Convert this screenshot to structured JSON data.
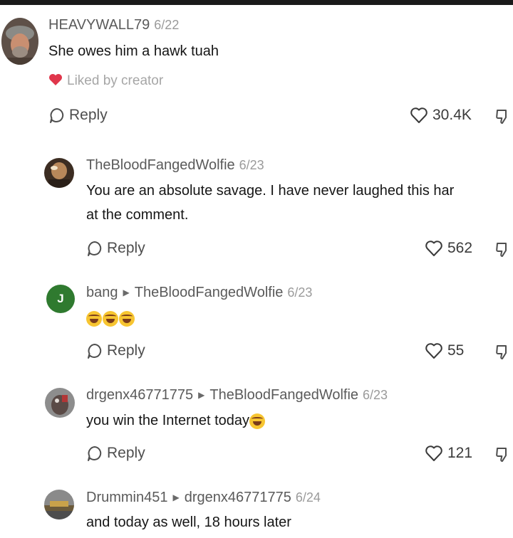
{
  "comments": [
    {
      "username": "HEAVYWALL79",
      "date": "6/22",
      "text": "She owes him a hawk tuah",
      "liked_label": "Liked by creator",
      "reply_label": "Reply",
      "likes": "30.4K"
    },
    {
      "username": "TheBloodFangedWolfie",
      "date": "6/23",
      "text_line1": "You are an absolute savage. I have never laughed this har",
      "text_line2": "at the comment.",
      "reply_label": "Reply",
      "likes": "562"
    },
    {
      "username": "bang",
      "reply_to": "TheBloodFangedWolfie",
      "date": "6/23",
      "avatar_letter": "J",
      "reply_label": "Reply",
      "likes": "55"
    },
    {
      "username": "drgenx46771775",
      "reply_to": "TheBloodFangedWolfie",
      "date": "6/23",
      "text": "you win the Internet today",
      "reply_label": "Reply",
      "likes": "121"
    },
    {
      "username": "Drummin451",
      "reply_to": "drgenx46771775",
      "date": "6/24",
      "text": "and today as well, 18 hours later"
    }
  ],
  "colors": {
    "heart_liked": "#e0364b",
    "avatar_j": "#2f7a2f"
  }
}
